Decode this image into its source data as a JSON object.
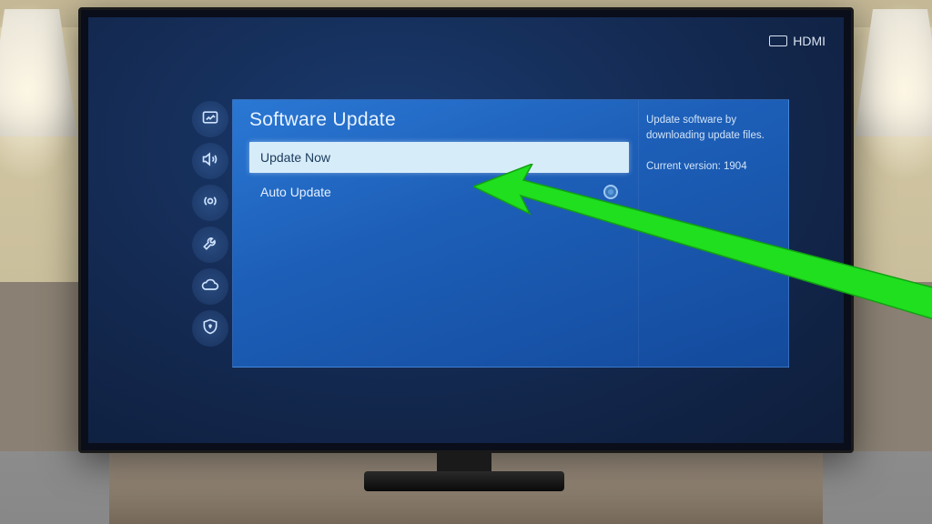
{
  "status": {
    "input_label": "HDMI"
  },
  "panel": {
    "title": "Software Update",
    "items": [
      {
        "label": "Update Now",
        "selected": true
      },
      {
        "label": "Auto Update",
        "selected": false
      }
    ]
  },
  "help": {
    "text": "Update software by downloading update files.",
    "version_label": "Current version:",
    "version_value": "1904"
  },
  "sidebar": {
    "icons": [
      "picture-icon",
      "sound-icon",
      "broadcast-icon",
      "general-icon",
      "support-icon",
      "privacy-icon"
    ]
  }
}
